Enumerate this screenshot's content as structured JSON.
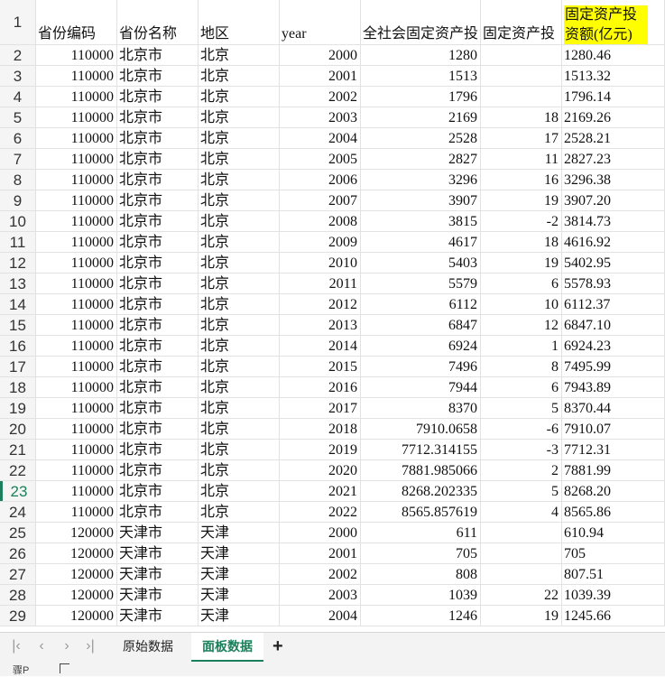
{
  "headers": {
    "row_label": "1",
    "col_b": "省份编码",
    "col_c": "省份名称",
    "col_d": "地区",
    "col_e": "year",
    "col_f": "全社会固定资产投",
    "col_g": "固定资产投",
    "col_h_line1": "固定资产投",
    "col_h_line2": "资额(亿元)"
  },
  "rows": [
    {
      "n": "2",
      "code": "110000",
      "prov": "北京市",
      "region": "北京",
      "year": "2000",
      "total": "1280",
      "rate": "",
      "amount": "1280.46"
    },
    {
      "n": "3",
      "code": "110000",
      "prov": "北京市",
      "region": "北京",
      "year": "2001",
      "total": "1513",
      "rate": "",
      "amount": "1513.32"
    },
    {
      "n": "4",
      "code": "110000",
      "prov": "北京市",
      "region": "北京",
      "year": "2002",
      "total": "1796",
      "rate": "",
      "amount": "1796.14"
    },
    {
      "n": "5",
      "code": "110000",
      "prov": "北京市",
      "region": "北京",
      "year": "2003",
      "total": "2169",
      "rate": "18",
      "amount": "2169.26"
    },
    {
      "n": "6",
      "code": "110000",
      "prov": "北京市",
      "region": "北京",
      "year": "2004",
      "total": "2528",
      "rate": "17",
      "amount": "2528.21"
    },
    {
      "n": "7",
      "code": "110000",
      "prov": "北京市",
      "region": "北京",
      "year": "2005",
      "total": "2827",
      "rate": "11",
      "amount": "2827.23"
    },
    {
      "n": "8",
      "code": "110000",
      "prov": "北京市",
      "region": "北京",
      "year": "2006",
      "total": "3296",
      "rate": "16",
      "amount": "3296.38"
    },
    {
      "n": "9",
      "code": "110000",
      "prov": "北京市",
      "region": "北京",
      "year": "2007",
      "total": "3907",
      "rate": "19",
      "amount": "3907.20"
    },
    {
      "n": "10",
      "code": "110000",
      "prov": "北京市",
      "region": "北京",
      "year": "2008",
      "total": "3815",
      "rate": "-2",
      "amount": "3814.73"
    },
    {
      "n": "11",
      "code": "110000",
      "prov": "北京市",
      "region": "北京",
      "year": "2009",
      "total": "4617",
      "rate": "18",
      "amount": "4616.92"
    },
    {
      "n": "12",
      "code": "110000",
      "prov": "北京市",
      "region": "北京",
      "year": "2010",
      "total": "5403",
      "rate": "19",
      "amount": "5402.95"
    },
    {
      "n": "13",
      "code": "110000",
      "prov": "北京市",
      "region": "北京",
      "year": "2011",
      "total": "5579",
      "rate": "6",
      "amount": "5578.93"
    },
    {
      "n": "14",
      "code": "110000",
      "prov": "北京市",
      "region": "北京",
      "year": "2012",
      "total": "6112",
      "rate": "10",
      "amount": "6112.37"
    },
    {
      "n": "15",
      "code": "110000",
      "prov": "北京市",
      "region": "北京",
      "year": "2013",
      "total": "6847",
      "rate": "12",
      "amount": "6847.10"
    },
    {
      "n": "16",
      "code": "110000",
      "prov": "北京市",
      "region": "北京",
      "year": "2014",
      "total": "6924",
      "rate": "1",
      "amount": "6924.23"
    },
    {
      "n": "17",
      "code": "110000",
      "prov": "北京市",
      "region": "北京",
      "year": "2015",
      "total": "7496",
      "rate": "8",
      "amount": "7495.99"
    },
    {
      "n": "18",
      "code": "110000",
      "prov": "北京市",
      "region": "北京",
      "year": "2016",
      "total": "7944",
      "rate": "6",
      "amount": "7943.89"
    },
    {
      "n": "19",
      "code": "110000",
      "prov": "北京市",
      "region": "北京",
      "year": "2017",
      "total": "8370",
      "rate": "5",
      "amount": "8370.44"
    },
    {
      "n": "20",
      "code": "110000",
      "prov": "北京市",
      "region": "北京",
      "year": "2018",
      "total": "7910.0658",
      "rate": "-6",
      "amount": "7910.07"
    },
    {
      "n": "21",
      "code": "110000",
      "prov": "北京市",
      "region": "北京",
      "year": "2019",
      "total": "7712.314155",
      "rate": "-3",
      "amount": "7712.31"
    },
    {
      "n": "22",
      "code": "110000",
      "prov": "北京市",
      "region": "北京",
      "year": "2020",
      "total": "7881.985066",
      "rate": "2",
      "amount": "7881.99"
    },
    {
      "n": "23",
      "code": "110000",
      "prov": "北京市",
      "region": "北京",
      "year": "2021",
      "total": "8268.202335",
      "rate": "5",
      "amount": "8268.20"
    },
    {
      "n": "24",
      "code": "110000",
      "prov": "北京市",
      "region": "北京",
      "year": "2022",
      "total": "8565.857619",
      "rate": "4",
      "amount": "8565.86"
    },
    {
      "n": "25",
      "code": "120000",
      "prov": "天津市",
      "region": "天津",
      "year": "2000",
      "total": "611",
      "rate": "",
      "amount": "610.94"
    },
    {
      "n": "26",
      "code": "120000",
      "prov": "天津市",
      "region": "天津",
      "year": "2001",
      "total": "705",
      "rate": "",
      "amount": "705"
    },
    {
      "n": "27",
      "code": "120000",
      "prov": "天津市",
      "region": "天津",
      "year": "2002",
      "total": "808",
      "rate": "",
      "amount": "807.51"
    },
    {
      "n": "28",
      "code": "120000",
      "prov": "天津市",
      "region": "天津",
      "year": "2003",
      "total": "1039",
      "rate": "22",
      "amount": "1039.39"
    },
    {
      "n": "29",
      "code": "120000",
      "prov": "天津市",
      "region": "天津",
      "year": "2004",
      "total": "1246",
      "rate": "19",
      "amount": "1245.66"
    }
  ],
  "selected_row": "23",
  "sheet_tabs": [
    {
      "label": "原始数据",
      "active": false
    },
    {
      "label": "面板数据",
      "active": true
    }
  ],
  "add_sheet_label": "+",
  "status_text": "骤P",
  "colors": {
    "accent": "#1a7f5a",
    "highlight": "#ffff00",
    "grid": "#e2e2e2"
  }
}
